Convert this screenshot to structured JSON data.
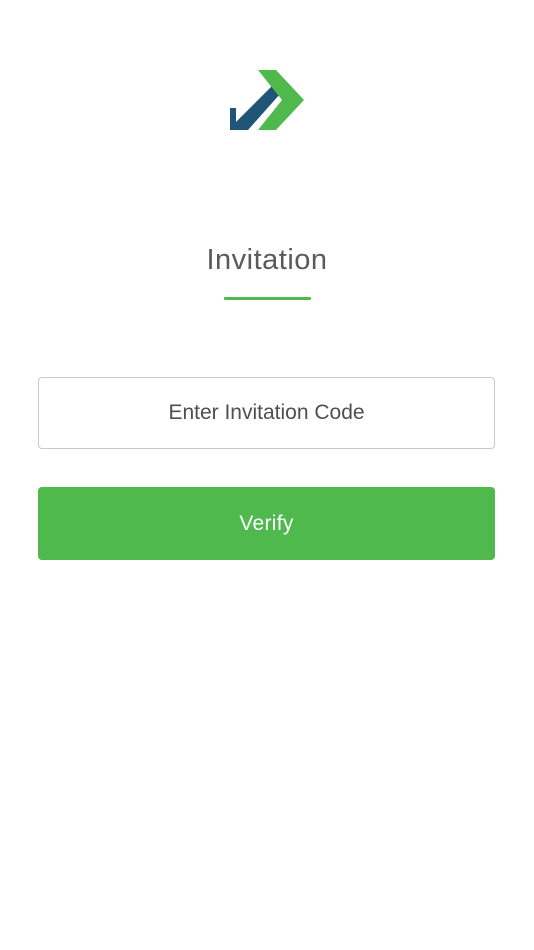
{
  "logo": {
    "icon": "check-arrow-logo-icon",
    "colors": {
      "green": "#50b94d",
      "navy": "#1f5576"
    }
  },
  "page": {
    "title": "Invitation",
    "accent_color": "#50b94d"
  },
  "form": {
    "code_placeholder": "Enter Invitation Code",
    "code_value": "",
    "verify_label": "Verify"
  }
}
